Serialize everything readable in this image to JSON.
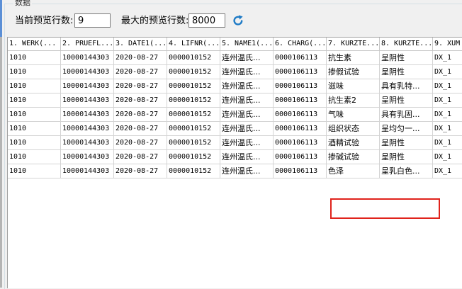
{
  "group": {
    "title": "数据"
  },
  "controls": {
    "preview_label": "当前预览行数:",
    "preview_value": "9",
    "max_label": "最大的预览行数:",
    "max_value": "8000",
    "refresh_icon": "refresh-icon",
    "accent": "#1f7bc6"
  },
  "grid": {
    "columns": [
      "1. WERK(...",
      "2. PRUEFL...",
      "3. DATE1(...",
      "4. LIFNR(...",
      "5. NAME1(...",
      "6. CHARG(...",
      "7. KURZTE...",
      "8. KURZTE...",
      "9. XUM"
    ],
    "rows": [
      [
        "1010",
        "10000144303",
        "2020-08-27",
        "0000010152",
        "连州温氏...",
        "0000106113",
        "抗生素",
        "呈阴性",
        "DX_1"
      ],
      [
        "1010",
        "10000144303",
        "2020-08-27",
        "0000010152",
        "连州温氏...",
        "0000106113",
        "掺假试验",
        "呈阴性",
        "DX_1"
      ],
      [
        "1010",
        "10000144303",
        "2020-08-27",
        "0000010152",
        "连州温氏...",
        "0000106113",
        "滋味",
        "具有乳特...",
        "DX_1"
      ],
      [
        "1010",
        "10000144303",
        "2020-08-27",
        "0000010152",
        "连州温氏...",
        "0000106113",
        "抗生素2",
        "呈阴性",
        "DX_1"
      ],
      [
        "1010",
        "10000144303",
        "2020-08-27",
        "0000010152",
        "连州温氏...",
        "0000106113",
        "气味",
        "具有乳固...",
        "DX_1"
      ],
      [
        "1010",
        "10000144303",
        "2020-08-27",
        "0000010152",
        "连州温氏...",
        "0000106113",
        "组织状态",
        "呈均匀一...",
        "DX_1"
      ],
      [
        "1010",
        "10000144303",
        "2020-08-27",
        "0000010152",
        "连州温氏...",
        "0000106113",
        "酒精试验",
        "呈阴性",
        "DX_1"
      ],
      [
        "1010",
        "10000144303",
        "2020-08-27",
        "0000010152",
        "连州温氏...",
        "0000106113",
        "掺碱试验",
        "呈阴性",
        "DX_1"
      ],
      [
        "1010",
        "10000144303",
        "2020-08-27",
        "0000010152",
        "连州温氏...",
        "0000106113",
        "色泽",
        "呈乳白色...",
        "DX_1"
      ]
    ],
    "highlight_color": "#e0231c"
  }
}
